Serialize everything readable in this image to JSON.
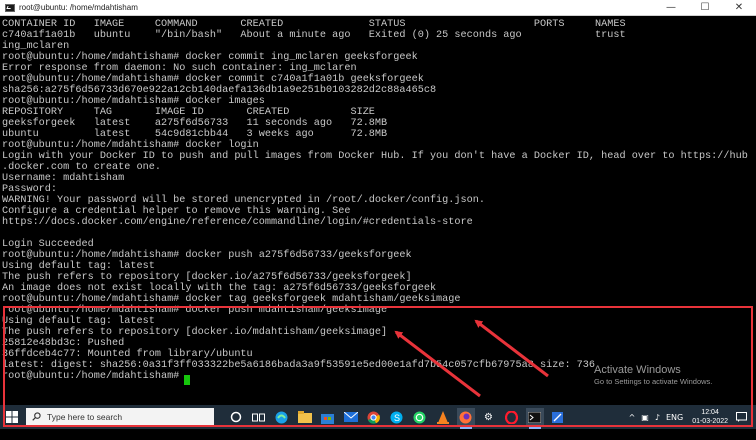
{
  "window": {
    "title": "root@ubuntu: /home/mdahtisham",
    "min": "—",
    "max": "☐",
    "close": "✕"
  },
  "terminal": {
    "lines": [
      "CONTAINER ID   IMAGE     COMMAND       CREATED              STATUS                     PORTS     NAMES",
      "c740a1f1a01b   ubuntu    \"/bin/bash\"   About a minute ago   Exited (0) 25 seconds ago            trust",
      "ing_mclaren",
      "root@ubuntu:/home/mdahtisham# docker commit ing_mclaren geeksforgeek",
      "Error response from daemon: No such container: ing_mclaren",
      "root@ubuntu:/home/mdahtisham# docker commit c740a1f1a01b geeksforgeek",
      "sha256:a275f6d56733d670e922a12cb140daefa136db1a9e251b0103282d2c88a465c8",
      "root@ubuntu:/home/mdahtisham# docker images",
      "REPOSITORY     TAG       IMAGE ID       CREATED          SIZE",
      "geeksforgeek   latest    a275f6d56733   11 seconds ago   72.8MB",
      "ubuntu         latest    54c9d81cbb44   3 weeks ago      72.8MB",
      "root@ubuntu:/home/mdahtisham# docker login",
      "Login with your Docker ID to push and pull images from Docker Hub. If you don't have a Docker ID, head over to https://hub",
      ".docker.com to create one.",
      "Username: mdahtisham",
      "Password:",
      "WARNING! Your password will be stored unencrypted in /root/.docker/config.json.",
      "Configure a credential helper to remove this warning. See",
      "https://docs.docker.com/engine/reference/commandline/login/#credentials-store",
      "",
      "Login Succeeded",
      "root@ubuntu:/home/mdahtisham# docker push a275f6d56733/geeksforgeek",
      "Using default tag: latest",
      "The push refers to repository [docker.io/a275f6d56733/geeksforgeek]",
      "An image does not exist locally with the tag: a275f6d56733/geeksforgeek",
      "root@ubuntu:/home/mdahtisham# docker tag geeksforgeek mdahtisham/geeksimage",
      "root@ubuntu:/home/mdahtisham# docker push mdahtisham/geeksimage",
      "Using default tag: latest",
      "The push refers to repository [docker.io/mdahtisham/geeksimage]",
      "25812e48bd3c: Pushed",
      "36ffdceb4c77: Mounted from library/ubuntu",
      "latest: digest: sha256:0a31f3ff033322be5a6186bada3a9f53591e5ed00e1afd7b54c057cfb67975a8 size: 736",
      "root@ubuntu:/home/mdahtisham# "
    ]
  },
  "watermark": {
    "title": "Activate Windows",
    "subtitle": "Go to Settings to activate Windows."
  },
  "taskbar": {
    "search_placeholder": "Type here to search",
    "language": "ENG",
    "time": "12:04",
    "date": "01-03-2022"
  },
  "colors": {
    "highlight": "#e8333a",
    "cursor": "#16c60c",
    "taskbar": "#1f2d3a"
  }
}
